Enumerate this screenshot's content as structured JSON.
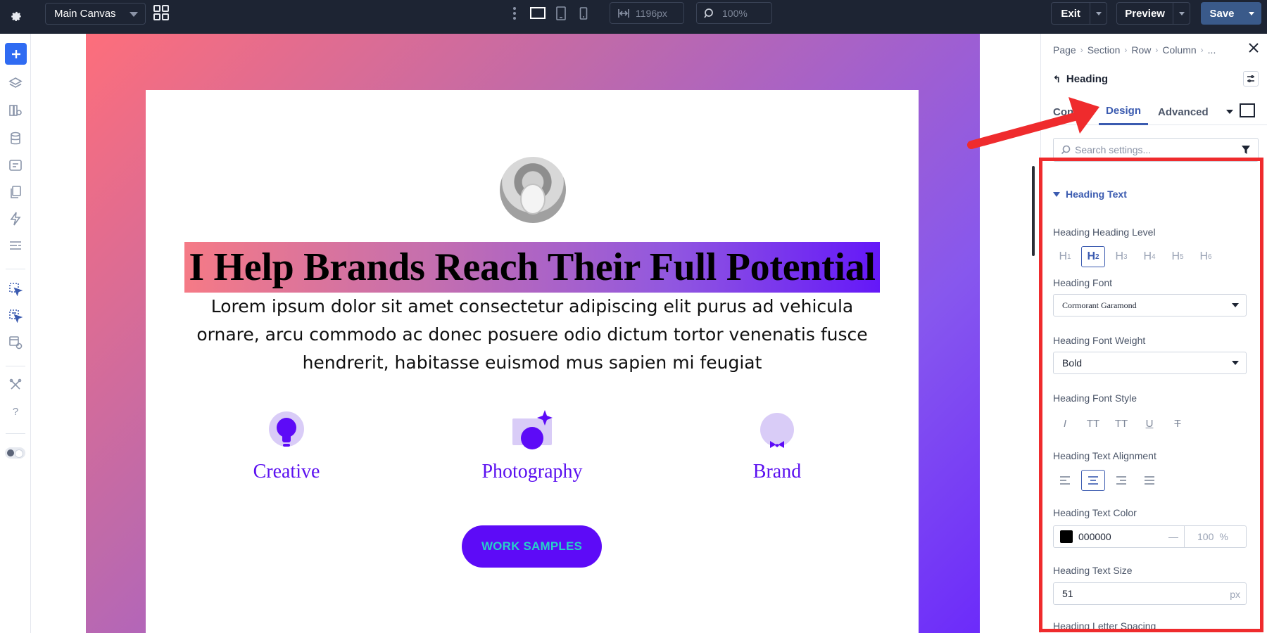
{
  "topbar": {
    "canvas_select": "Main Canvas",
    "width_value": "1196px",
    "zoom_value": "100%",
    "exit_label": "Exit",
    "preview_label": "Preview",
    "save_label": "Save"
  },
  "canvas": {
    "heading": "I Help Brands Reach Their Full Potential",
    "body": "Lorem ipsum dolor sit amet consectetur adipiscing elit purus ad vehicula ornare, arcu commodo ac donec posuere odio dictum tortor venenatis fusce hendrerit, habitasse euismod mus sapien mi feugiat",
    "features": [
      {
        "label": "Creative",
        "icon": "lightbulb-icon"
      },
      {
        "label": "Photography",
        "icon": "camera-icon"
      },
      {
        "label": "Brand",
        "icon": "badge-icon"
      }
    ],
    "button_label": "WORK SAMPLES",
    "colors": {
      "accent": "#5d0bf7",
      "button_text": "#27d0c8",
      "gradient_start": "#fd6e7b",
      "gradient_end": "#6c2bfa"
    }
  },
  "panel": {
    "breadcrumb": [
      "Page",
      "Section",
      "Row",
      "Column",
      "..."
    ],
    "module_title": "Heading",
    "tabs": {
      "content": "Content",
      "design": "Design",
      "advanced": "Advanced"
    },
    "search_placeholder": "Search settings...",
    "section_title": "Heading Text",
    "fields": {
      "level_label": "Heading Heading Level",
      "levels": [
        "H",
        "H",
        "H",
        "H",
        "H",
        "H"
      ],
      "levels_sub": [
        "1",
        "2",
        "3",
        "4",
        "5",
        "6"
      ],
      "selected_level": "H2",
      "font_label": "Heading Font",
      "font_value": "Cormorant Garamond",
      "weight_label": "Heading Font Weight",
      "weight_value": "Bold",
      "style_label": "Heading Font Style",
      "style_buttons": [
        "I",
        "TT",
        "TT",
        "U",
        "T"
      ],
      "align_label": "Heading Text Alignment",
      "selected_alignment": "center",
      "color_label": "Heading Text Color",
      "color_value": "000000",
      "opacity_value": "100",
      "opacity_unit": "%",
      "size_label": "Heading Text Size",
      "size_value": "51",
      "size_unit": "px",
      "letter_spacing_label": "Heading Letter Spacing"
    }
  }
}
